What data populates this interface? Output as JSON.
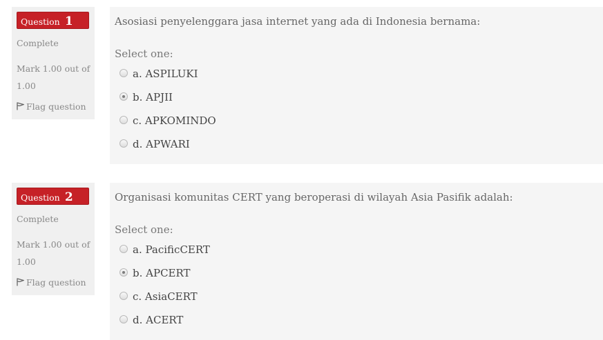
{
  "questions": [
    {
      "label": "Question",
      "number": "1",
      "state": "Complete",
      "grade": "Mark 1.00 out of 1.00",
      "flag": "Flag question",
      "text": "Asosiasi penyelenggara jasa internet yang ada di Indonesia bernama:",
      "prompt": "Select one:",
      "options": [
        {
          "label": "a. ASPILUKI",
          "checked": false
        },
        {
          "label": "b. APJII",
          "checked": true
        },
        {
          "label": "c. APKOMINDO",
          "checked": false
        },
        {
          "label": "d. APWARI",
          "checked": false
        }
      ]
    },
    {
      "label": "Question",
      "number": "2",
      "state": "Complete",
      "grade": "Mark 1.00 out of 1.00",
      "flag": "Flag question",
      "text": "Organisasi komunitas CERT yang beroperasi di wilayah Asia Pasifik adalah:",
      "prompt": "Select one:",
      "options": [
        {
          "label": "a. PacificCERT",
          "checked": false
        },
        {
          "label": "b. APCERT",
          "checked": true
        },
        {
          "label": "c. AsiaCERT",
          "checked": false
        },
        {
          "label": "d. ACERT",
          "checked": false
        }
      ]
    }
  ],
  "colors": {
    "question_badge": "#c62127",
    "panel": "#f5f5f5",
    "info_panel": "#f0f0f0"
  },
  "icons": {
    "flag": "flag-icon"
  }
}
